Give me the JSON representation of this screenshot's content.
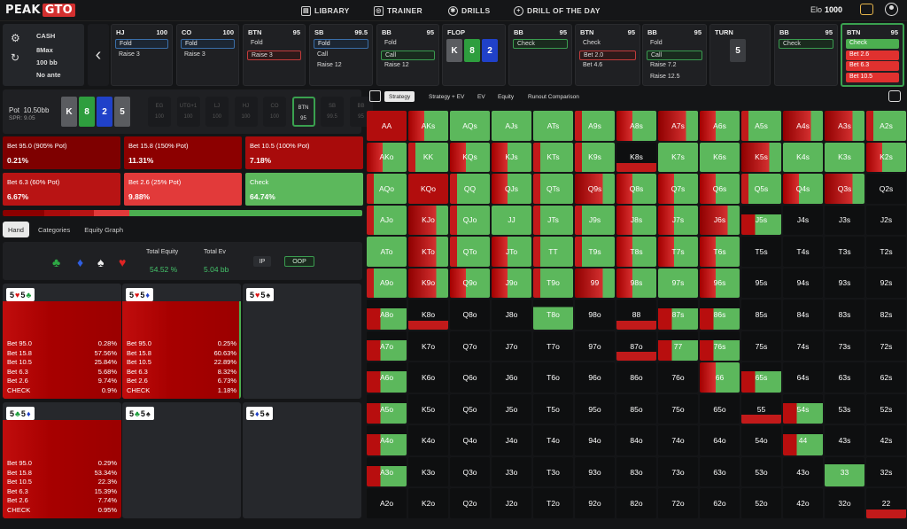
{
  "brand": {
    "part1": "PEAK",
    "part2": "GTO"
  },
  "nav": [
    {
      "label": "LIBRARY",
      "icon": "book-icon"
    },
    {
      "label": "TRAINER",
      "icon": "gamepad-icon"
    },
    {
      "label": "DRILLS",
      "icon": "drills-icon"
    },
    {
      "label": "DRILL OF THE DAY",
      "icon": "plus-circle-icon"
    }
  ],
  "elo": {
    "label": "Elo",
    "value": "1000"
  },
  "settings": {
    "game": "CASH",
    "table": "8Max",
    "stack": "100 bb",
    "ante": "No ante"
  },
  "actions": [
    {
      "pos": "HJ",
      "stack": "100",
      "items": [
        {
          "t": "Fold",
          "s": "sel-blue"
        },
        {
          "t": "Raise 3",
          "s": ""
        }
      ]
    },
    {
      "pos": "CO",
      "stack": "100",
      "items": [
        {
          "t": "Fold",
          "s": "sel-blue"
        },
        {
          "t": "Raise 3",
          "s": ""
        }
      ]
    },
    {
      "pos": "BTN",
      "stack": "95",
      "items": [
        {
          "t": "Fold",
          "s": ""
        },
        {
          "t": "Raise 3",
          "s": "sel-red"
        }
      ]
    },
    {
      "pos": "SB",
      "stack": "99.5",
      "items": [
        {
          "t": "Fold",
          "s": "sel-blue"
        },
        {
          "t": "Call",
          "s": ""
        },
        {
          "t": "Raise 12",
          "s": ""
        }
      ]
    },
    {
      "pos": "BB",
      "stack": "95",
      "items": [
        {
          "t": "Fold",
          "s": ""
        },
        {
          "t": "Call",
          "s": "sel-green"
        },
        {
          "t": "Raise 12",
          "s": ""
        }
      ]
    },
    {
      "pos": "FLOP",
      "stack": "",
      "board": true
    },
    {
      "pos": "BB",
      "stack": "95",
      "items": [
        {
          "t": "Check",
          "s": "sel-green"
        }
      ]
    },
    {
      "pos": "BTN",
      "stack": "95",
      "items": [
        {
          "t": "Check",
          "s": ""
        },
        {
          "t": "Bet 2.0",
          "s": "sel-red"
        },
        {
          "t": "Bet 4.6",
          "s": ""
        }
      ]
    },
    {
      "pos": "BB",
      "stack": "95",
      "items": [
        {
          "t": "Fold",
          "s": ""
        },
        {
          "t": "Call",
          "s": "sel-green"
        },
        {
          "t": "Raise 7.2",
          "s": ""
        },
        {
          "t": "Raise 12.5",
          "s": ""
        }
      ]
    },
    {
      "pos": "TURN",
      "stack": "",
      "turn": true
    },
    {
      "pos": "BB",
      "stack": "95",
      "items": [
        {
          "t": "Check",
          "s": "sel-green"
        }
      ]
    },
    {
      "pos": "BTN",
      "stack": "95",
      "active": true,
      "items": [
        {
          "t": "Check",
          "s": "fill-green"
        },
        {
          "t": "Bet 2.6",
          "s": "fill-red"
        },
        {
          "t": "Bet 6.3",
          "s": "fill-red"
        },
        {
          "t": "Bet 10.5",
          "s": "fill-red"
        }
      ]
    }
  ],
  "flop_cards": [
    {
      "rank": "K",
      "color": "c-gray"
    },
    {
      "rank": "8",
      "color": "c-green"
    },
    {
      "rank": "2",
      "color": "c-blue"
    }
  ],
  "turn_card": "5",
  "pot": {
    "label": "Pot",
    "value": "10.50bb",
    "spr": "SPR: 9.05"
  },
  "board_mini": [
    {
      "rank": "K",
      "color": "c-gray"
    },
    {
      "rank": "8",
      "color": "c-green"
    },
    {
      "rank": "2",
      "color": "c-blue"
    },
    {
      "rank": "5",
      "color": "c-gray"
    }
  ],
  "seats": [
    {
      "name": "EG",
      "stack": "100"
    },
    {
      "name": "UTG+1",
      "stack": "100"
    },
    {
      "name": "LJ",
      "stack": "100"
    },
    {
      "name": "HJ",
      "stack": "100"
    },
    {
      "name": "CO",
      "stack": "100"
    },
    {
      "name": "BTN",
      "stack": "95",
      "active": true
    },
    {
      "name": "SB",
      "stack": "99.5"
    },
    {
      "name": "BB",
      "stack": "95"
    }
  ],
  "strategies": [
    {
      "label": "Bet 95.0 (905% Pot)",
      "pct": "0.21%",
      "color": "#7e0000"
    },
    {
      "label": "Bet 15.8 (150% Pot)",
      "pct": "11.31%",
      "color": "#8c0000"
    },
    {
      "label": "Bet 10.5 (100% Pot)",
      "pct": "7.18%",
      "color": "#a80b0b"
    },
    {
      "label": "Bet 6.3 (60% Pot)",
      "pct": "6.67%",
      "color": "#b81414"
    },
    {
      "label": "Bet 2.6 (25% Pot)",
      "pct": "9.88%",
      "color": "#e23a3a"
    },
    {
      "label": "Check",
      "pct": "64.74%",
      "color": "#5cb85c"
    }
  ],
  "freq_bar": [
    {
      "pct": 0.21,
      "color": "#7e0000"
    },
    {
      "pct": 11.31,
      "color": "#8c0000"
    },
    {
      "pct": 7.18,
      "color": "#a80b0b"
    },
    {
      "pct": 6.67,
      "color": "#b81414"
    },
    {
      "pct": 9.88,
      "color": "#e23a3a"
    },
    {
      "pct": 64.74,
      "color": "#4caf50"
    }
  ],
  "left_tabs": [
    "Hand",
    "Categories",
    "Equity Graph"
  ],
  "equity": {
    "total_equity_label": "Total Equity",
    "total_equity": "54.52 %",
    "total_ev_label": "Total Ev",
    "total_ev": "5.04 bb",
    "ip": "IP",
    "oop": "OOP"
  },
  "combos": [
    {
      "cards": [
        {
          "r": "5",
          "s": "♥",
          "c": "#d11"
        },
        {
          "r": "5",
          "s": "♣",
          "c": "#1a9e3a"
        }
      ],
      "rows": [
        [
          "Bet 95.0",
          "0.28%"
        ],
        [
          "Bet 15.8",
          "57.56%"
        ],
        [
          "Bet 10.5",
          "25.84%"
        ],
        [
          "Bet 6.3",
          "5.68%"
        ],
        [
          "Bet 2.6",
          "9.74%"
        ],
        [
          "CHECK",
          "0.9%"
        ]
      ]
    },
    {
      "cards": [
        {
          "r": "5",
          "s": "♥",
          "c": "#d11"
        },
        {
          "r": "5",
          "s": "♦",
          "c": "#2041c9"
        }
      ],
      "rows": [
        [
          "Bet 95.0",
          "0.25%"
        ],
        [
          "Bet 15.8",
          "60.63%"
        ],
        [
          "Bet 10.5",
          "22.89%"
        ],
        [
          "Bet 6.3",
          "8.32%"
        ],
        [
          "Bet 2.6",
          "6.73%"
        ],
        [
          "CHECK",
          "1.18%"
        ]
      ]
    },
    {
      "cards": [
        {
          "r": "5",
          "s": "♥",
          "c": "#d11"
        },
        {
          "r": "5",
          "s": "♠",
          "c": "#222"
        }
      ],
      "rows": []
    },
    {
      "cards": [
        {
          "r": "5",
          "s": "♣",
          "c": "#1a9e3a"
        },
        {
          "r": "5",
          "s": "♦",
          "c": "#2041c9"
        }
      ],
      "rows": [
        [
          "Bet 95.0",
          "0.29%"
        ],
        [
          "Bet 15.8",
          "53.34%"
        ],
        [
          "Bet 10.5",
          "22.3%"
        ],
        [
          "Bet 6.3",
          "15.39%"
        ],
        [
          "Bet 2.6",
          "7.74%"
        ],
        [
          "CHECK",
          "0.95%"
        ]
      ]
    },
    {
      "cards": [
        {
          "r": "5",
          "s": "♣",
          "c": "#1a9e3a"
        },
        {
          "r": "5",
          "s": "♠",
          "c": "#222"
        }
      ],
      "rows": []
    },
    {
      "cards": [
        {
          "r": "5",
          "s": "♦",
          "c": "#2041c9"
        },
        {
          "r": "5",
          "s": "♠",
          "c": "#222"
        }
      ],
      "rows": []
    }
  ],
  "grid_tabs": [
    "Strategy",
    "Strategy + EV",
    "EV",
    "Equity",
    "Runout Comparison"
  ],
  "hands": [
    [
      "AA:r",
      "AKs:mix",
      "AQs:g",
      "AJs:g",
      "ATs:g",
      "A9s:mixg",
      "A8s:mix",
      "A7s:mixr",
      "A6s:mix",
      "A5s:mixg",
      "A4s:mixr",
      "A3s:mixr",
      "A2s:mixg"
    ],
    [
      "AKo:mix",
      "KK:mixg",
      "KQs:mix",
      "KJs:mix",
      "KTs:mixg",
      "K9s:mixg",
      "K8s:partr",
      "K7s:g",
      "K6s:g",
      "K5s:mixr",
      "K4s:g",
      "K3s:g",
      "K2s:mix"
    ],
    [
      "AQo:mixg",
      "KQo:r",
      "QQ:mixg",
      "QJs:mix",
      "QTs:mixg",
      "Q9s:mixr",
      "Q8s:mix",
      "Q7s:mix",
      "Q6s:mix",
      "Q5s:mixg",
      "Q4s:mix",
      "Q3s:mixr",
      "Q2s:n"
    ],
    [
      "AJo:mixg",
      "KJo:mixr",
      "QJo:mixg",
      "JJ:g",
      "JTs:mixg",
      "J9s:mixg",
      "J8s:mix",
      "J7s:mix",
      "J6s:mixr",
      "J5s:partmix",
      "J4s:n",
      "J3s:n",
      "J2s:n"
    ],
    [
      "ATo:g",
      "KTo:mixr",
      "QTo:mixg",
      "JTo:mix",
      "TT:mixg",
      "T9s:mixg",
      "T8s:mix",
      "T7s:mix",
      "T6s:mix",
      "T5s:n",
      "T4s:n",
      "T3s:n",
      "T2s:n"
    ],
    [
      "A9o:mixg",
      "K9o:mixr",
      "Q9o:mix",
      "J9o:mix",
      "T9o:mixg",
      "99:mixr",
      "98s:mix",
      "97s:g",
      "96s:mix",
      "95s:n",
      "94s:n",
      "93s:n",
      "92s:n"
    ],
    [
      "A8o:partmix",
      "K8o:partr",
      "Q8o:n",
      "J8o:n",
      "T8o:partg",
      "98o:n",
      "88:partr",
      "87s:partmix",
      "86s:partmix",
      "85s:n",
      "84s:n",
      "83s:n",
      "82s:n"
    ],
    [
      "A7o:partmix",
      "K7o:n",
      "Q7o:n",
      "J7o:n",
      "T7o:n",
      "97o:n",
      "87o:partr",
      "77:partmix",
      "76s:partmix",
      "75s:n",
      "74s:n",
      "73s:n",
      "72s:n"
    ],
    [
      "A6o:partmix",
      "K6o:n",
      "Q6o:n",
      "J6o:n",
      "T6o:n",
      "96o:n",
      "86o:n",
      "76o:n",
      "66:mix",
      "65s:partmix",
      "64s:n",
      "63s:n",
      "62s:n"
    ],
    [
      "A5o:partmix",
      "K5o:n",
      "Q5o:n",
      "J5o:n",
      "T5o:n",
      "95o:n",
      "85o:n",
      "75o:n",
      "65o:n",
      "55:partr",
      "54s:partmix",
      "53s:n",
      "52s:n"
    ],
    [
      "A4o:partmix",
      "K4o:n",
      "Q4o:n",
      "J4o:n",
      "T4o:n",
      "94o:n",
      "84o:n",
      "74o:n",
      "64o:n",
      "54o:n",
      "44:partmix",
      "43s:n",
      "42s:n"
    ],
    [
      "A3o:partmix",
      "K3o:n",
      "Q3o:n",
      "J3o:n",
      "T3o:n",
      "93o:n",
      "83o:n",
      "73o:n",
      "63o:n",
      "53o:n",
      "43o:n",
      "33:partg",
      "32s:n"
    ],
    [
      "A2o:n",
      "K2o:n",
      "Q2o:n",
      "J2o:n",
      "T2o:n",
      "92o:n",
      "82o:n",
      "72o:n",
      "62o:n",
      "52o:n",
      "42o:n",
      "32o:n",
      "22:partr"
    ]
  ]
}
